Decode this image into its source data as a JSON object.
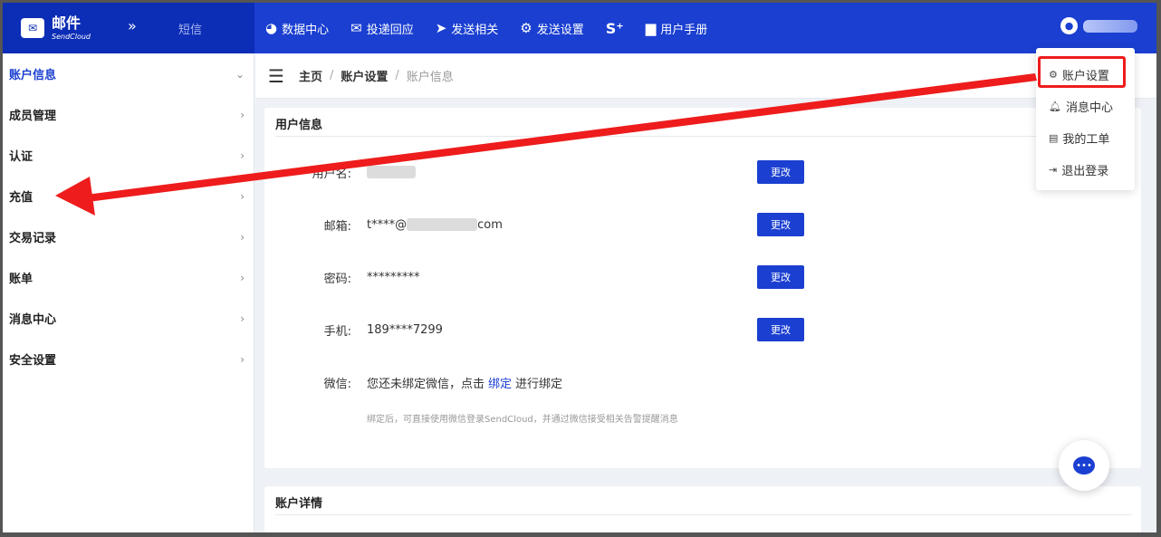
{
  "brand": {
    "title": "邮件",
    "subtitle": "SendCloud",
    "toggle": "»",
    "sms": "短信"
  },
  "nav": [
    {
      "label": "数据中心",
      "icon": "pie-chart-icon"
    },
    {
      "label": "投递回应",
      "icon": "mail-open-icon"
    },
    {
      "label": "发送相关",
      "icon": "paper-plane-icon"
    },
    {
      "label": "发送设置",
      "icon": "gear-icon"
    },
    {
      "label": "S⁺",
      "icon": "s-plus-icon"
    },
    {
      "label": "用户手册",
      "icon": "folder-icon"
    }
  ],
  "sidebar": {
    "items": [
      {
        "label": "账户信息",
        "active": true,
        "chevron": "⌄"
      },
      {
        "label": "成员管理",
        "chevron": "›"
      },
      {
        "label": "认证",
        "chevron": "›"
      },
      {
        "label": "充值",
        "chevron": "›"
      },
      {
        "label": "交易记录",
        "chevron": "›"
      },
      {
        "label": "账单",
        "chevron": "›"
      },
      {
        "label": "消息中心",
        "chevron": "›"
      },
      {
        "label": "安全设置",
        "chevron": "›"
      }
    ]
  },
  "breadcrumb": {
    "home": "主页",
    "sep": "/",
    "section": "账户设置",
    "current": "账户信息"
  },
  "user_info": {
    "title": "用户信息",
    "rows": [
      {
        "label": "用户名:",
        "value": "",
        "button": "更改"
      },
      {
        "label": "邮箱:",
        "value_prefix": "t****@",
        "value_suffix": "com",
        "button": "更改"
      },
      {
        "label": "密码:",
        "value": "*********",
        "button": "更改"
      },
      {
        "label": "手机:",
        "value": "189****7299",
        "button": "更改"
      }
    ],
    "wechat": {
      "label": "微信:",
      "text_before": "您还未绑定微信，点击",
      "link": "绑定",
      "text_after": "进行绑定",
      "note": "绑定后，可直接使用微信登录SendCloud，并通过微信接受相关告警提醒消息"
    }
  },
  "account_detail": {
    "title": "账户详情"
  },
  "dropdown": {
    "items": [
      {
        "label": "账户设置",
        "icon": "gear-icon"
      },
      {
        "label": "消息中心",
        "icon": "bell-icon"
      },
      {
        "label": "我的工单",
        "icon": "document-icon"
      },
      {
        "label": "退出登录",
        "icon": "logout-icon"
      }
    ]
  },
  "colors": {
    "primary": "#1a3fd1",
    "brand_bg": "#0c2db6",
    "annotation": "#ee1c1c"
  }
}
